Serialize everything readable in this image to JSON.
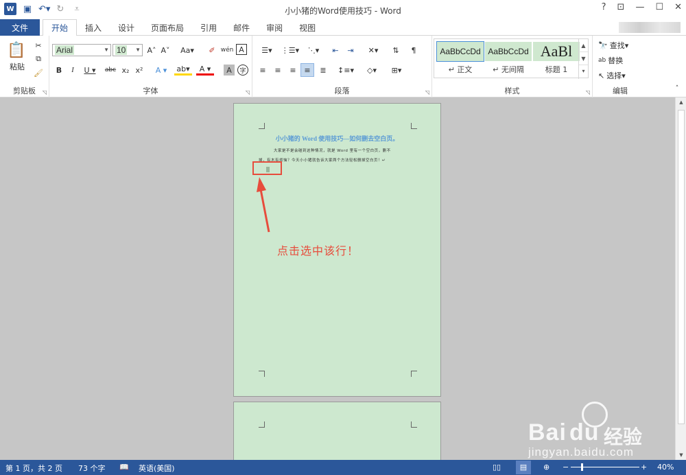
{
  "window": {
    "title": "小小猪的Word使用技巧 - Word",
    "controls": [
      "?",
      "⊡",
      "—",
      "☐",
      "✕"
    ]
  },
  "quick_access": {
    "logo": "W",
    "icons": [
      "save-icon",
      "undo-icon",
      "redo-icon",
      "customize-icon"
    ]
  },
  "ribbon": {
    "file_tab": "文件",
    "tabs": [
      "开始",
      "插入",
      "设计",
      "页面布局",
      "引用",
      "邮件",
      "审阅",
      "视图"
    ],
    "active_tab": "开始",
    "clipboard": {
      "label": "剪贴板",
      "paste": "粘贴"
    },
    "font": {
      "label": "字体",
      "name": "Arial",
      "size": "10",
      "case_button": "Aa"
    },
    "paragraph": {
      "label": "段落"
    },
    "styles": {
      "label": "样式",
      "items": [
        {
          "preview": "AaBbCcDd",
          "name": "↵ 正文"
        },
        {
          "preview": "AaBbCcDd",
          "name": "↵ 无间隔"
        },
        {
          "preview": "AaBl",
          "name": "标题 1"
        }
      ]
    },
    "editing": {
      "label": "编辑",
      "find": "查找",
      "replace": "替换",
      "select": "选择"
    }
  },
  "document": {
    "title": "小小猪的 Word 使用技巧—如何删去空白页。",
    "body_line1": "大家是不是会碰到这种情况，就是 Word 里有一个空白页，删不",
    "body_line2": "掉，有木有烦恼？今天小小猪就告诉大家两个方法轻松删掉空白页！↵"
  },
  "annotation": {
    "text": "点击选中该行！",
    "color": "#e74c3c"
  },
  "statusbar": {
    "page": "第 1 页，共 2 页",
    "words": "73 个字",
    "language": "英语(美国)",
    "zoom": "40%",
    "zoom_value": 40
  },
  "watermark": {
    "brand": "Bai",
    "paw": "du",
    "product": "经验",
    "url": "jingyan.baidu.com"
  },
  "colors": {
    "accent": "#2b579a",
    "page_bg": "#cde8cf",
    "annotation": "#e74c3c",
    "title_text": "#5b9bd5"
  }
}
